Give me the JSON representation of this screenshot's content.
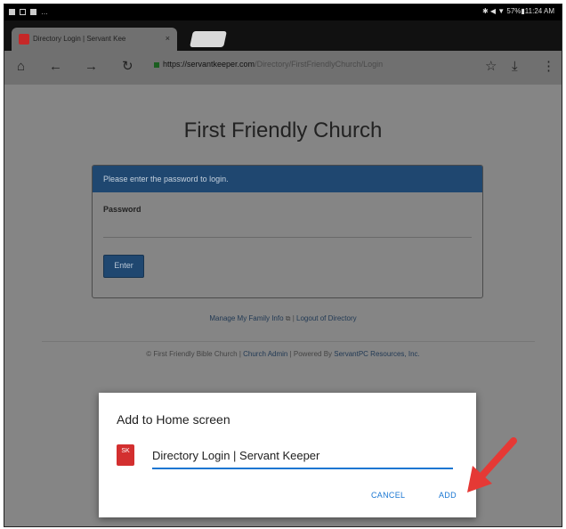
{
  "status_bar": {
    "time": "11:24 AM",
    "battery": "57%",
    "right_text": "✱ ◀ ▼ 57%▮11:24 AM"
  },
  "browser": {
    "tab_title": "Directory Login | Servant Kee",
    "tab_close": "×",
    "url_host": "https://servantkeeper.com",
    "url_path": "/Directory/FirstFriendlyChurch/Login"
  },
  "page": {
    "title": "First Friendly Church",
    "panel_heading": "Please enter the password to login.",
    "password_label": "Password",
    "enter_button": "Enter",
    "links": {
      "manage": "Manage My Family Info",
      "separator": " | ",
      "logout": "Logout of Directory"
    },
    "footer": {
      "copyright": "© First Friendly Bible Church | ",
      "admin": "Church Admin",
      "powered": " | Powered By ",
      "vendor": "ServantPC Resources, Inc."
    }
  },
  "dialog": {
    "title": "Add to Home screen",
    "app_name": "Directory Login | Servant Keeper",
    "icon_letters": "SK",
    "cancel": "CANCEL",
    "add": "ADD"
  },
  "colors": {
    "panel_header": "#1f4770",
    "dialog_accent": "#1976d2",
    "arrow": "#e53935",
    "favicon": "#d32f2f"
  }
}
